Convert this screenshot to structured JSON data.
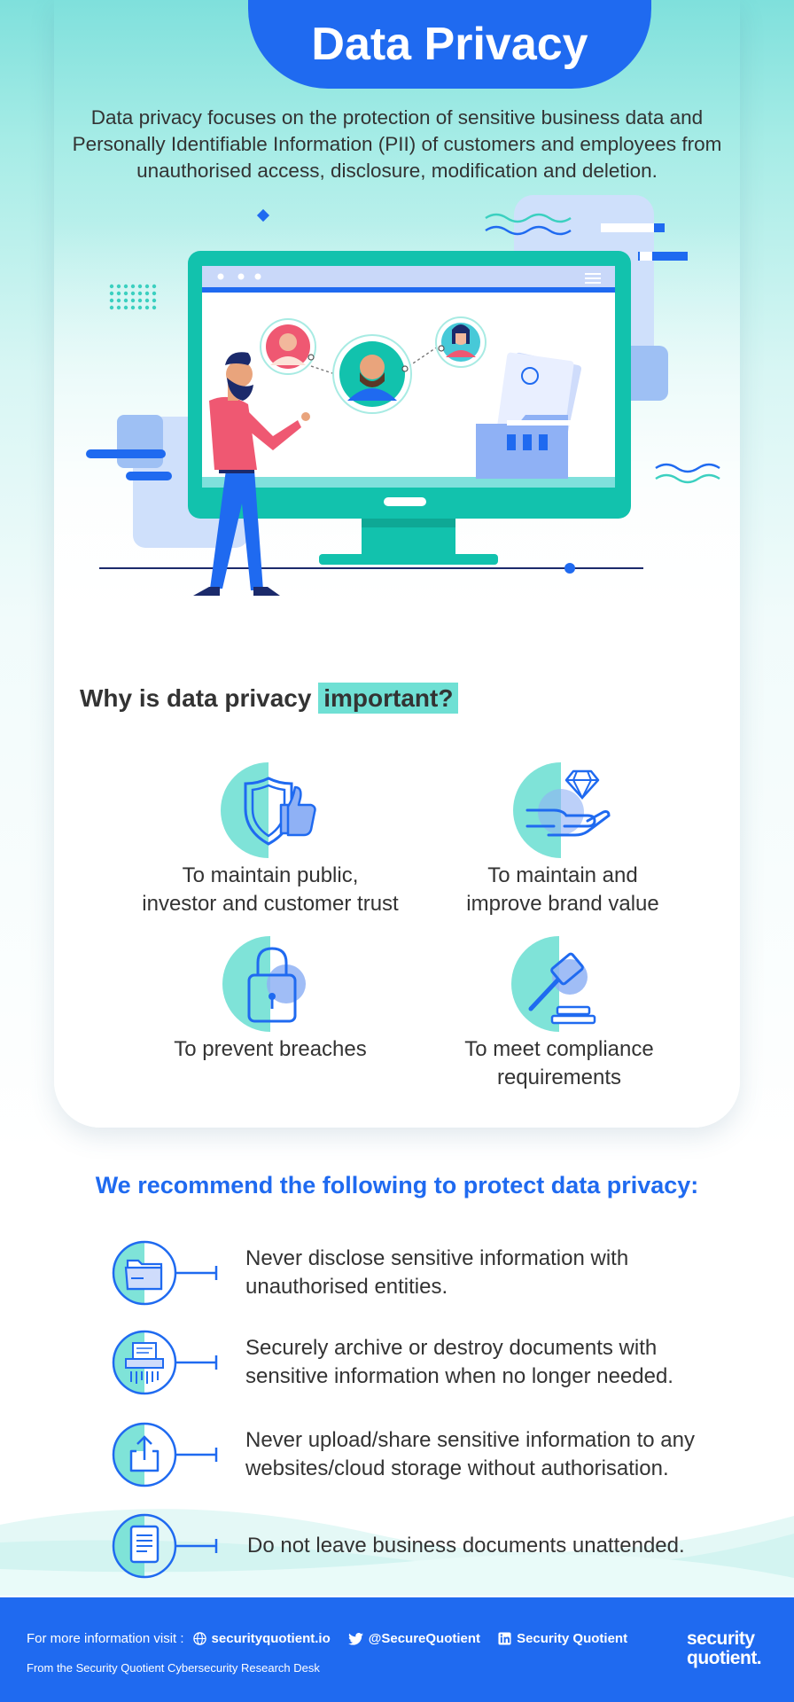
{
  "header": {
    "title": "Data Privacy"
  },
  "intro": "Data privacy focuses on the protection of sensitive business data and Personally Identifiable Information (PII) of customers and employees from unauthorised access, disclosure, modification and deletion.",
  "why": {
    "heading_prefix": "Why is data privacy ",
    "heading_highlight": "important?"
  },
  "benefits": [
    {
      "line1": "To maintain public,",
      "line2": "investor and customer trust",
      "icon": "shield-thumbs-up-icon"
    },
    {
      "line1": "To maintain and",
      "line2": "improve brand value",
      "icon": "hand-diamond-icon"
    },
    {
      "line1": "To prevent breaches",
      "line2": "",
      "icon": "padlock-icon"
    },
    {
      "line1": "To meet compliance",
      "line2": "requirements",
      "icon": "gavel-icon"
    }
  ],
  "recommend": {
    "title": "We recommend the following to protect data privacy:",
    "items": [
      {
        "line1": "Never disclose sensitive information with",
        "line2": "unauthorised entities.",
        "icon": "folder-icon"
      },
      {
        "line1": "Securely archive or destroy documents with",
        "line2": "sensitive information when no longer needed.",
        "icon": "shredder-icon"
      },
      {
        "line1": "Never upload/share sensitive information to any",
        "line2": "websites/cloud storage without authorisation.",
        "icon": "upload-icon"
      },
      {
        "line1": "Do not leave business documents unattended.",
        "line2": "",
        "icon": "document-icon"
      }
    ]
  },
  "footer": {
    "info_label": "For more information visit :",
    "website": "securityquotient.io",
    "twitter": "@SecureQuotient",
    "linkedin": "Security Quotient",
    "desk": "From the Security Quotient Cybersecurity Research Desk",
    "brand_line1": "security",
    "brand_line2": "quotient.",
    "brand_tm": "™"
  },
  "colors": {
    "blue": "#1f6af0",
    "teal": "#6fe0d4",
    "dark_text": "#333333"
  }
}
